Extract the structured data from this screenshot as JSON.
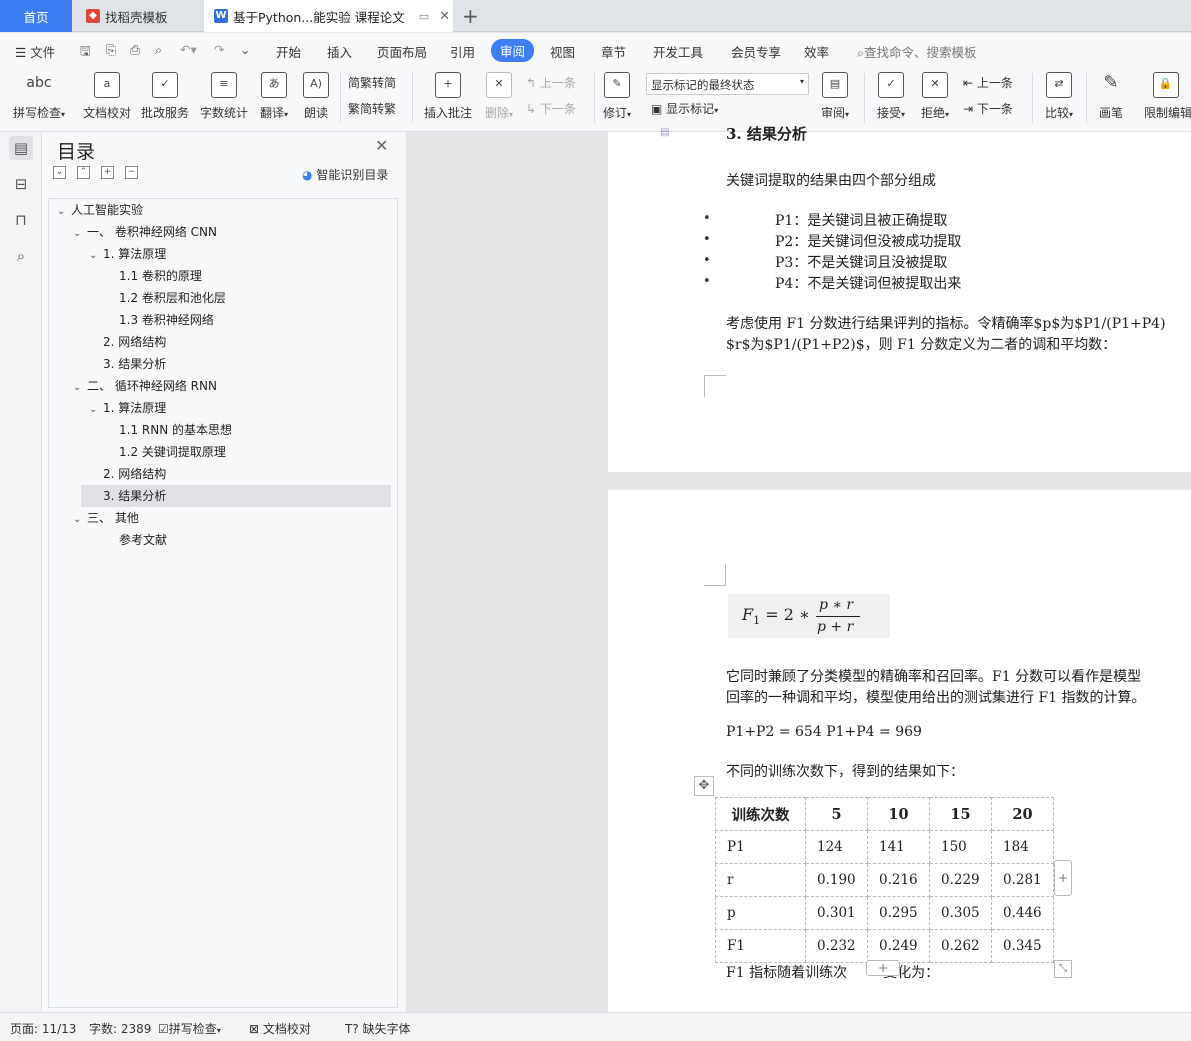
{
  "tabs": {
    "home": "首页",
    "find_template": "找稻壳模板",
    "document": "基于Python...能实验 课程论文"
  },
  "menu": {
    "file": "文件",
    "items": [
      "开始",
      "插入",
      "页面布局",
      "引用",
      "审阅",
      "视图",
      "章节",
      "开发工具",
      "会员专享",
      "效率"
    ],
    "search": "查找命令、搜索模板"
  },
  "ribbon": {
    "spell": "拼写检查",
    "proofread": "文档校对",
    "review_service": "批改服务",
    "wordcount": "字数统计",
    "translate": "翻译",
    "read_aloud": "朗读",
    "trad_to_simp": "繁转简",
    "simp_to_trad": "简转繁",
    "insert_comment": "插入批注",
    "delete": "删除",
    "prev": "上一条",
    "next": "下一条",
    "track": "修订",
    "markup_state": "显示标记的最终状态",
    "show_markup": "显示标记",
    "review": "审阅",
    "accept": "接受",
    "reject": "拒绝",
    "prev2": "上一条",
    "next2": "下一条",
    "compare": "比较",
    "pen": "画笔",
    "restrict": "限制编辑"
  },
  "toc": {
    "title": "目录",
    "smart": "智能识别目录",
    "items": [
      "人工智能实验",
      "一、  卷积神经网络 CNN",
      "1. 算法原理",
      "1.1 卷积的原理",
      "1.2 卷积层和池化层",
      "1.3 卷积神经网络",
      "2. 网络结构",
      "3. 结果分析",
      "二、  循环神经网络 RNN",
      "1. 算法原理",
      "1.1 RNN 的基本思想",
      "1.2 关键词提取原理",
      "2. 网络结构",
      "3. 结果分析",
      "三、  其他",
      "参考文献"
    ]
  },
  "doc": {
    "heading": "3. 结果分析",
    "intro": "关键词提取的结果由四个部分组成",
    "bullets": [
      "P1：是关键词且被正确提取",
      "P2：是关键词但没被成功提取",
      "P3：不是关键词且没被提取",
      "P4：不是关键词但被提取出来"
    ],
    "para1_line1": "考虑使用 F1 分数进行结果评判的指标。令精确率$p$为$P1/(P1+P4)",
    "para1_line2": "$r$为$P1/(P1+P2)$，则 F1 分数定义为二者的调和平均数：",
    "formula_lhs": "F",
    "formula_sub": "1",
    "formula_eq": " = 2 ∗ ",
    "formula_num": "p ∗ r",
    "formula_den": "p + r",
    "para2_line1": "它同时兼顾了分类模型的精确率和召回率。F1 分数可以看作是模型",
    "para2_line2": "回率的一种调和平均，模型使用给出的测试集进行 F1 指数的计算。",
    "sums": "P1+P2 = 654 P1+P4 = 969",
    "table_intro": "不同的训练次数下，得到的结果如下：",
    "table": [
      [
        "训练次数",
        "5",
        "10",
        "15",
        "20"
      ],
      [
        "P1",
        "124",
        "141",
        "150",
        "184"
      ],
      [
        "r",
        "0.190",
        "0.216",
        "0.229",
        "0.281"
      ],
      [
        "p",
        "0.301",
        "0.295",
        "0.305",
        "0.446"
      ],
      [
        "F1",
        "0.232",
        "0.249",
        "0.262",
        "0.345"
      ]
    ],
    "after_table_a": "F1 指标随着训练次",
    "after_table_b": "变化为："
  },
  "status": {
    "page": "页面: 11/13",
    "words": "字数: 2389",
    "spell": "拼写检查",
    "proof": "文档校对",
    "missing_font": "缺失字体"
  }
}
